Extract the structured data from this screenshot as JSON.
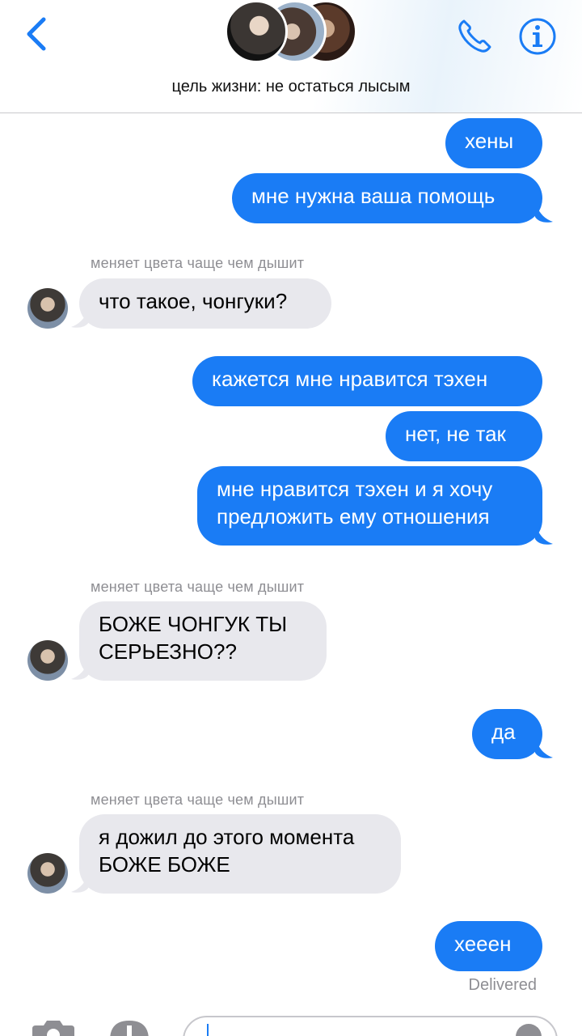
{
  "header": {
    "group_title": "цель жизни: не остаться лысым",
    "accent_color": "#1a7cf5",
    "icons": [
      "chevron-left-icon",
      "phone-icon",
      "info-icon"
    ]
  },
  "messages": [
    {
      "direction": "out",
      "text": "хены"
    },
    {
      "direction": "out",
      "text": "мне нужна ваша помощь"
    },
    {
      "direction": "in",
      "sender": "меняет цвета чаще чем дышит",
      "text": "что такое, чонгуки?"
    },
    {
      "direction": "out",
      "text": "кажется мне нравится тэхен"
    },
    {
      "direction": "out",
      "text": "нет, не так"
    },
    {
      "direction": "out",
      "text": "мне нравится тэхен и я хочу\nпредложить ему отношения"
    },
    {
      "direction": "in",
      "sender": "меняет цвета чаще чем дышит",
      "text": "БОЖЕ ЧОНГУК ТЫ\nСЕРЬЕЗНО??"
    },
    {
      "direction": "out",
      "text": "да"
    },
    {
      "direction": "in",
      "sender": "меняет цвета чаще чем дышит",
      "text": "я дожил до этого момента\nБОЖЕ БОЖЕ"
    },
    {
      "direction": "out",
      "text": "хееен"
    }
  ],
  "status": {
    "delivered": "Delivered"
  },
  "input": {
    "icons": [
      "camera-icon",
      "app-store-icon",
      "microphone-icon"
    ]
  }
}
